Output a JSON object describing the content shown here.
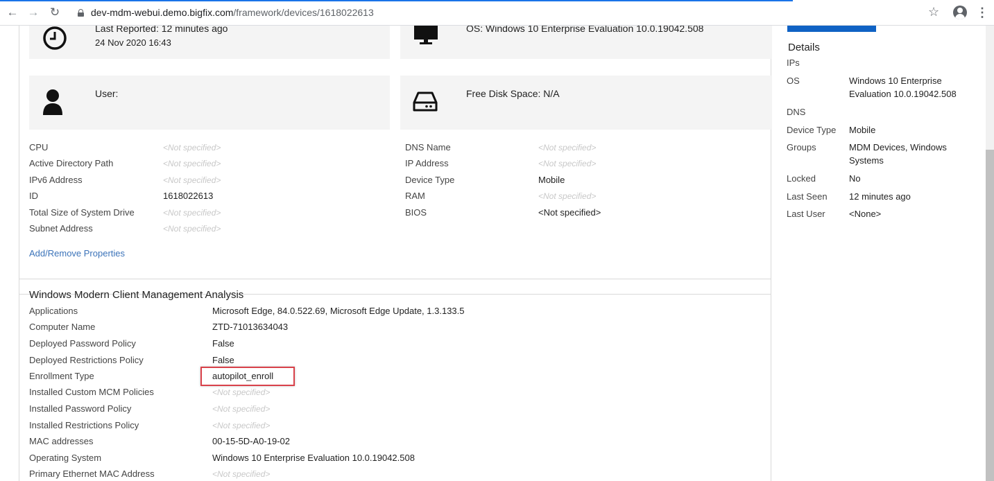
{
  "browser": {
    "url_host": "dev-mdm-webui.demo.bigfix.com",
    "url_path": "/framework/devices/1618022613",
    "back_icon": "arrow-left-icon",
    "forward_icon": "arrow-right-icon",
    "reload_icon": "reload-icon"
  },
  "tiles": {
    "last_reported": "Last Reported: 12 minutes ago",
    "last_reported_date": "24 Nov 2020 16:43",
    "os": "OS: Windows 10 Enterprise Evaluation 10.0.19042.508",
    "user": "User:",
    "free_disk": "Free Disk Space: N/A"
  },
  "properties_left": [
    {
      "label": "CPU",
      "value": "<Not specified>"
    },
    {
      "label": "Active Directory Path",
      "value": "<Not specified>"
    },
    {
      "label": "IPv6 Address",
      "value": "<Not specified>"
    },
    {
      "label": "ID",
      "value": "1618022613"
    },
    {
      "label": "Total Size of System Drive",
      "value": "<Not specified>"
    },
    {
      "label": "Subnet Address",
      "value": "<Not specified>"
    }
  ],
  "properties_right": [
    {
      "label": "DNS Name",
      "value": "<Not specified>"
    },
    {
      "label": "IP Address",
      "value": "<Not specified>"
    },
    {
      "label": "Device Type",
      "value": "Mobile"
    },
    {
      "label": "RAM",
      "value": "<Not specified>"
    },
    {
      "label": "BIOS",
      "value": "<Not specified>"
    }
  ],
  "add_remove_link": "Add/Remove Properties",
  "analysis": {
    "title": "Windows Modern Client Management Analysis",
    "rows": [
      {
        "label": "Applications",
        "value": "Microsoft Edge, 84.0.522.69, Microsoft Edge Update, 1.3.133.5"
      },
      {
        "label": "Computer Name",
        "value": "ZTD-71013634043"
      },
      {
        "label": "Deployed Password Policy",
        "value": "False"
      },
      {
        "label": "Deployed Restrictions Policy",
        "value": "False"
      },
      {
        "label": "Enrollment Type",
        "value": "autopilot_enroll"
      },
      {
        "label": "Installed Custom MCM Policies",
        "value": "<Not specified>"
      },
      {
        "label": "Installed Password Policy",
        "value": "<Not specified>"
      },
      {
        "label": "Installed Restrictions Policy",
        "value": "<Not specified>"
      },
      {
        "label": "MAC addresses",
        "value": "00-15-5D-A0-19-02"
      },
      {
        "label": "Operating System",
        "value": "Windows 10 Enterprise Evaluation 10.0.19042.508"
      },
      {
        "label": "Primary Ethernet MAC Address",
        "value": "<Not specified>"
      }
    ]
  },
  "details": {
    "heading": "Details",
    "rows": [
      {
        "label": "IPs",
        "value": ""
      },
      {
        "label": "OS",
        "value": "Windows 10 Enterprise Evaluation 10.0.19042.508"
      },
      {
        "label": "DNS",
        "value": ""
      },
      {
        "label": "Device Type",
        "value": "Mobile"
      },
      {
        "label": "Groups",
        "value": "MDM Devices, Windows Systems"
      },
      {
        "label": "Locked",
        "value": "No"
      },
      {
        "label": "Last Seen",
        "value": "12 minutes ago"
      },
      {
        "label": "Last User",
        "value": "<None>"
      }
    ]
  },
  "colors": {
    "accent": "#0f62c4",
    "link": "#3b73b9",
    "highlight": "#d9414a"
  }
}
